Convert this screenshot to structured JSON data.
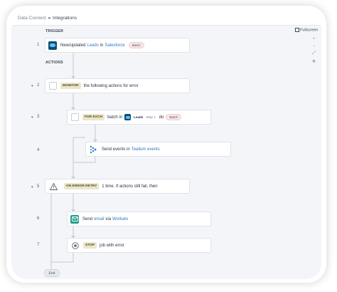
{
  "breadcrumb": {
    "parent": "Data Connect",
    "separator": "»",
    "current": "Integrations"
  },
  "toolbar": {
    "fullscreen_label": "Fullscreen"
  },
  "zoom_controls": [
    "+",
    "−",
    "⤢",
    "✥"
  ],
  "sections": {
    "trigger": "TRIGGER",
    "actions": "ACTIONS"
  },
  "steps": [
    {
      "num": "1",
      "text_a": "New/updated",
      "link_a": "Leads",
      "text_b": "in",
      "link_b": "Salesforce",
      "pill": "Batch"
    },
    {
      "num": "2",
      "tag": "MONITOR",
      "text": "the following actions for error"
    },
    {
      "num": "3",
      "tag": "FOR EACH",
      "text_a": "batch in",
      "mini_obj": "Leads",
      "mini_step": "Step 1",
      "text_b": "do",
      "pill": "Batch"
    },
    {
      "num": "4",
      "text_a": "Send events in",
      "link": "Tealium events"
    },
    {
      "num": "5",
      "tag": "ON ERROR RETRY",
      "text": "1 time. If actions still fail, then"
    },
    {
      "num": "6",
      "text_a": "Send",
      "link_a": "email",
      "text_b": "via",
      "link_b": "Workato"
    },
    {
      "num": "7",
      "tag": "STOP",
      "text": "job with error"
    }
  ],
  "end_label": "End"
}
